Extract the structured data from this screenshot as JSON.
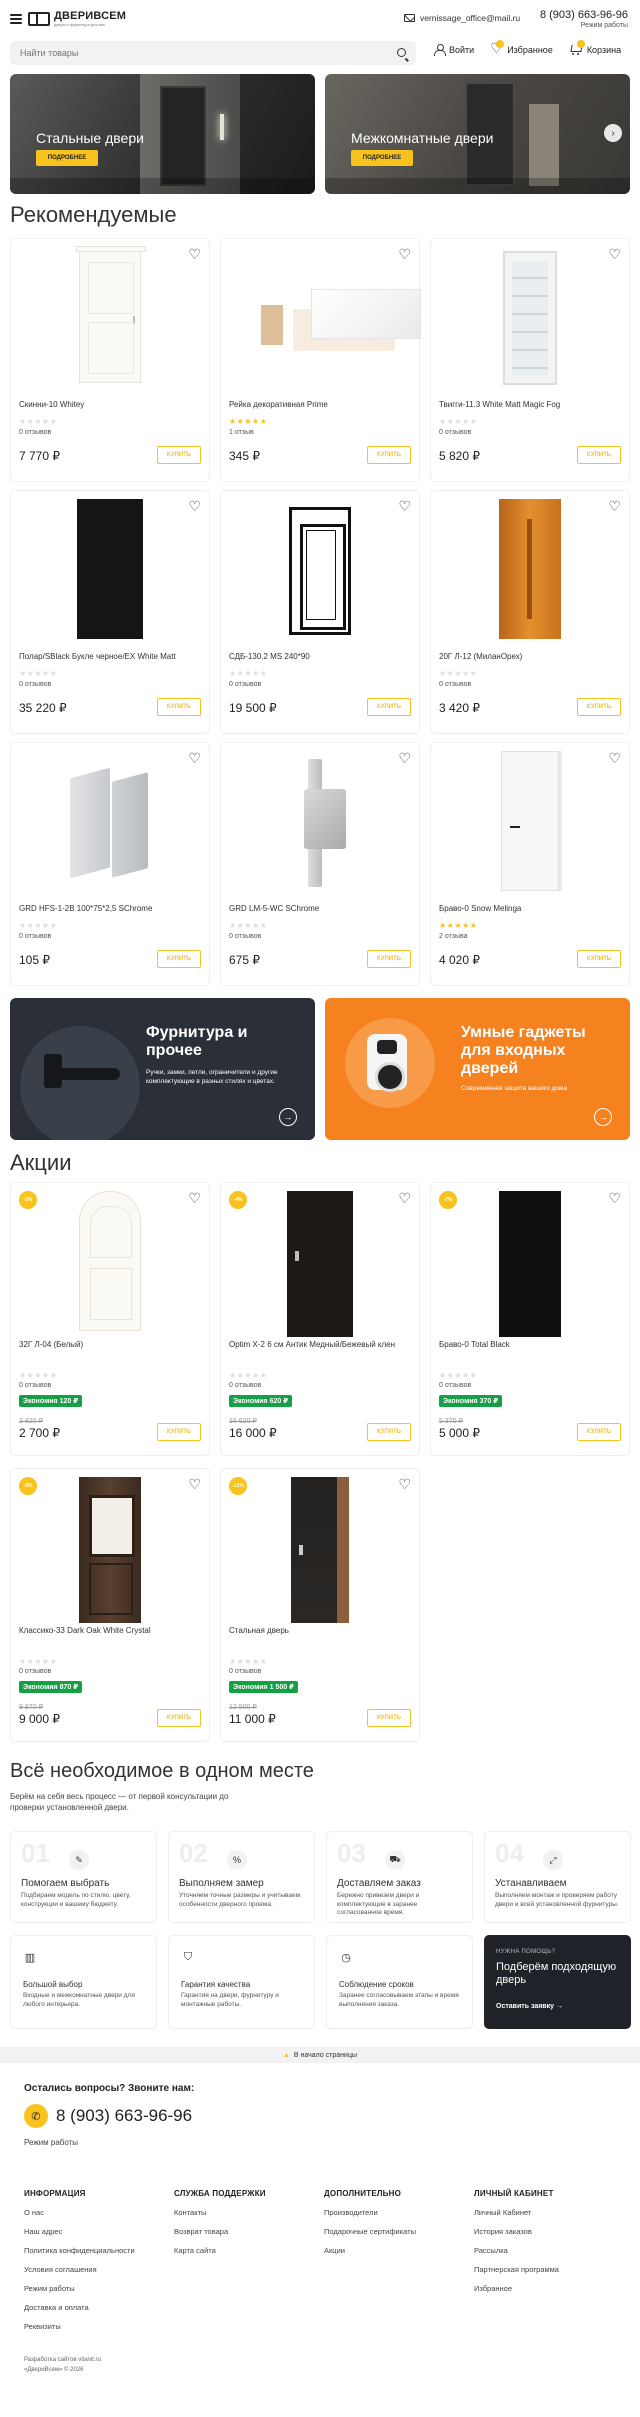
{
  "header": {
    "logo_name": "ДВЕРИВСЕМ",
    "logo_sub": "двери и фурнитура для вас",
    "email": "vernissage_office@mail.ru",
    "phone": "8 (903) 663-96-96",
    "phone_sub": "Режим работы"
  },
  "search": {
    "placeholder": "Найти товары"
  },
  "user_actions": {
    "login": "Войти",
    "favorites": "Избранное",
    "cart": "Корзина"
  },
  "hero": [
    {
      "title": "Стальные двери",
      "button": "ПОДРОБНЕЕ"
    },
    {
      "title": "Межкомнатные двери",
      "button": "ПОДРОБНЕЕ"
    }
  ],
  "sections": {
    "recommended": "Рекомендуемые",
    "promotions": "Акции"
  },
  "buy_label": "КУПИТЬ",
  "recommended": [
    {
      "name": "Скинни-10 Whitey",
      "reviews": "0 отзывов",
      "price": "7 770 ₽",
      "rated": false
    },
    {
      "name": "Рейка декоративная Prime",
      "reviews": "1 отзыв",
      "price": "345 ₽",
      "rated": true
    },
    {
      "name": "Твигги-11.3 White Matt Magic Fog",
      "reviews": "0 отзывов",
      "price": "5 820 ₽",
      "rated": false
    },
    {
      "name": "Полар/SBlack Букле черное/EX White Matt",
      "reviews": "0 отзывов",
      "price": "35 220 ₽",
      "rated": false
    },
    {
      "name": "СДБ-130.2 MS 240*90",
      "reviews": "0 отзывов",
      "price": "19 500 ₽",
      "rated": false
    },
    {
      "name": "20Г Л-12 (МиланОрех)",
      "reviews": "0 отзывов",
      "price": "3 420 ₽",
      "rated": false
    },
    {
      "name": "GRD HFS-1-2B 100*75*2,5 SChrome",
      "reviews": "0 отзывов",
      "price": "105 ₽",
      "rated": false
    },
    {
      "name": "GRD LM-5-WC SChrome",
      "reviews": "0 отзывов",
      "price": "675 ₽",
      "rated": false
    },
    {
      "name": "Браво-0 Snow Melinga",
      "reviews": "2 отзыва",
      "price": "4 020 ₽",
      "rated": true
    }
  ],
  "features": [
    {
      "title": "Фурнитура и прочее",
      "desc": "Ручки, замки, петли, ограничители и другие комплектующие в разных стилях и цветах."
    },
    {
      "title": "Умные гаджеты для входных дверей",
      "desc": "Современная защита вашего дома"
    }
  ],
  "promotions": [
    {
      "badge": "-5%",
      "name": "32Г Л-04 (Белый)",
      "reviews": "0 отзывов",
      "economy": "Экономия 120 ₽",
      "old_price": "2 820 ₽",
      "price": "2 700 ₽"
    },
    {
      "badge": "-4%",
      "name": "Optim X-2 6 см Антик Медный/Бежевый клен",
      "reviews": "0 отзывов",
      "economy": "Экономия 620 ₽",
      "old_price": "16 620 ₽",
      "price": "16 000 ₽"
    },
    {
      "badge": "-7%",
      "name": "Браво-0 Total Black",
      "reviews": "0 отзывов",
      "economy": "Экономия 370 ₽",
      "old_price": "5 370 ₽",
      "price": "5 000 ₽"
    },
    {
      "badge": "-9%",
      "name": "Классико-33 Dark Oak White Crystal",
      "reviews": "0 отзывов",
      "economy": "Экономия 870 ₽",
      "old_price": "9 870 ₽",
      "price": "9 000 ₽"
    },
    {
      "badge": "-12%",
      "name": "Стальная дверь",
      "reviews": "0 отзывов",
      "economy": "Экономия 1 500 ₽",
      "old_price": "12 500 ₽",
      "price": "11 000 ₽"
    }
  ],
  "all_in_one": {
    "title": "Всё необходимое в одном месте",
    "desc": "Берём на себя весь процесс — от первой консультации до проверки установленной двери.",
    "steps": [
      {
        "num": "01",
        "icon": "✎",
        "title": "Помогаем выбрать",
        "desc": "Подбираем модель по стилю, цвету, конструкции и вашему бюджету."
      },
      {
        "num": "02",
        "icon": "%",
        "title": "Выполняем замер",
        "desc": "Уточняем точные размеры и учитываем особенности дверного проема."
      },
      {
        "num": "03",
        "icon": "⛟",
        "title": "Доставляем заказ",
        "desc": "Бережно привезем двери и комплектующие в заранее согласованное время."
      },
      {
        "num": "04",
        "icon": "⤢",
        "title": "Устанавливаем",
        "desc": "Выполняем монтаж и проверяем работу двери и всей установленной фурнитуры."
      }
    ],
    "benefits": [
      {
        "icon": "▥",
        "title": "Большой выбор",
        "desc": "Входные и межкомнатные двери для любого интерьера."
      },
      {
        "icon": "⛉",
        "title": "Гарантия качества",
        "desc": "Гарантия на двери, фурнитуру и монтажные работы."
      },
      {
        "icon": "◷",
        "title": "Соблюдение сроков",
        "desc": "Заранее согласовываем этапы и время выполнения заказа."
      }
    ],
    "help": {
      "small": "НУЖНА ПОМОЩЬ?",
      "title": "Подберём подходящую дверь",
      "link": "Оставить заявку →"
    }
  },
  "to_top": "В начало страницы",
  "footer": {
    "question": "Остались вопросы? Звоните нам:",
    "phone": "8 (903) 663-96-96",
    "hours": "Режим работы",
    "columns": [
      {
        "title": "ИНФОРМАЦИЯ",
        "links": [
          "О нас",
          "Наш адрес",
          "Политика конфиденциальности",
          "Условия соглашения",
          "Режим работы",
          "Доставка и оплата",
          "Реквизиты"
        ]
      },
      {
        "title": "СЛУЖБА ПОДДЕРЖКИ",
        "links": [
          "Контакты",
          "Возврат товара",
          "Карта сайта"
        ]
      },
      {
        "title": "ДОПОЛНИТЕЛЬНО",
        "links": [
          "Производители",
          "Подарочные сертификаты",
          "Акции"
        ]
      },
      {
        "title": "ЛИЧНЫЙ КАБИНЕТ",
        "links": [
          "Личный Кабинет",
          "История заказов",
          "Рассылка",
          "Партнерская программа",
          "Избранное"
        ]
      }
    ],
    "credit": "Разработка сайтов vitanit.ru",
    "copyright": "«ДвериВсем» © 2026"
  }
}
